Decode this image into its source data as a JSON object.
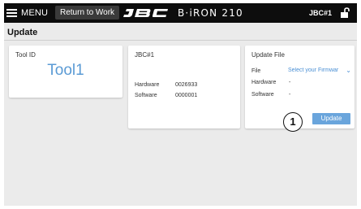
{
  "topbar": {
    "menu_label": "MENU",
    "return_label": "Return to Work",
    "brand": "JBC",
    "product": "B·iRON 210",
    "station": "JBC#1"
  },
  "page": {
    "title": "Update"
  },
  "tool_card": {
    "title": "Tool ID",
    "tool_name": "Tool1"
  },
  "station_card": {
    "title": "JBC#1",
    "hardware_label": "Hardware",
    "hardware_value": "0026933",
    "software_label": "Software",
    "software_value": "0000001"
  },
  "update_card": {
    "title": "Update File",
    "file_label": "File",
    "file_select": "Select your Firmwar",
    "hardware_label": "Hardware",
    "hardware_value": "-",
    "software_label": "Software",
    "software_value": "-",
    "callout_number": "1",
    "update_button": "Update"
  },
  "colors": {
    "accent": "#5b9bd5",
    "button": "#6aa5dc",
    "topbar": "#0d0d0d"
  },
  "icons": [
    "hamburger-icon",
    "jbc-logo",
    "unlocked-padlock-icon",
    "chevron-down-icon"
  ]
}
